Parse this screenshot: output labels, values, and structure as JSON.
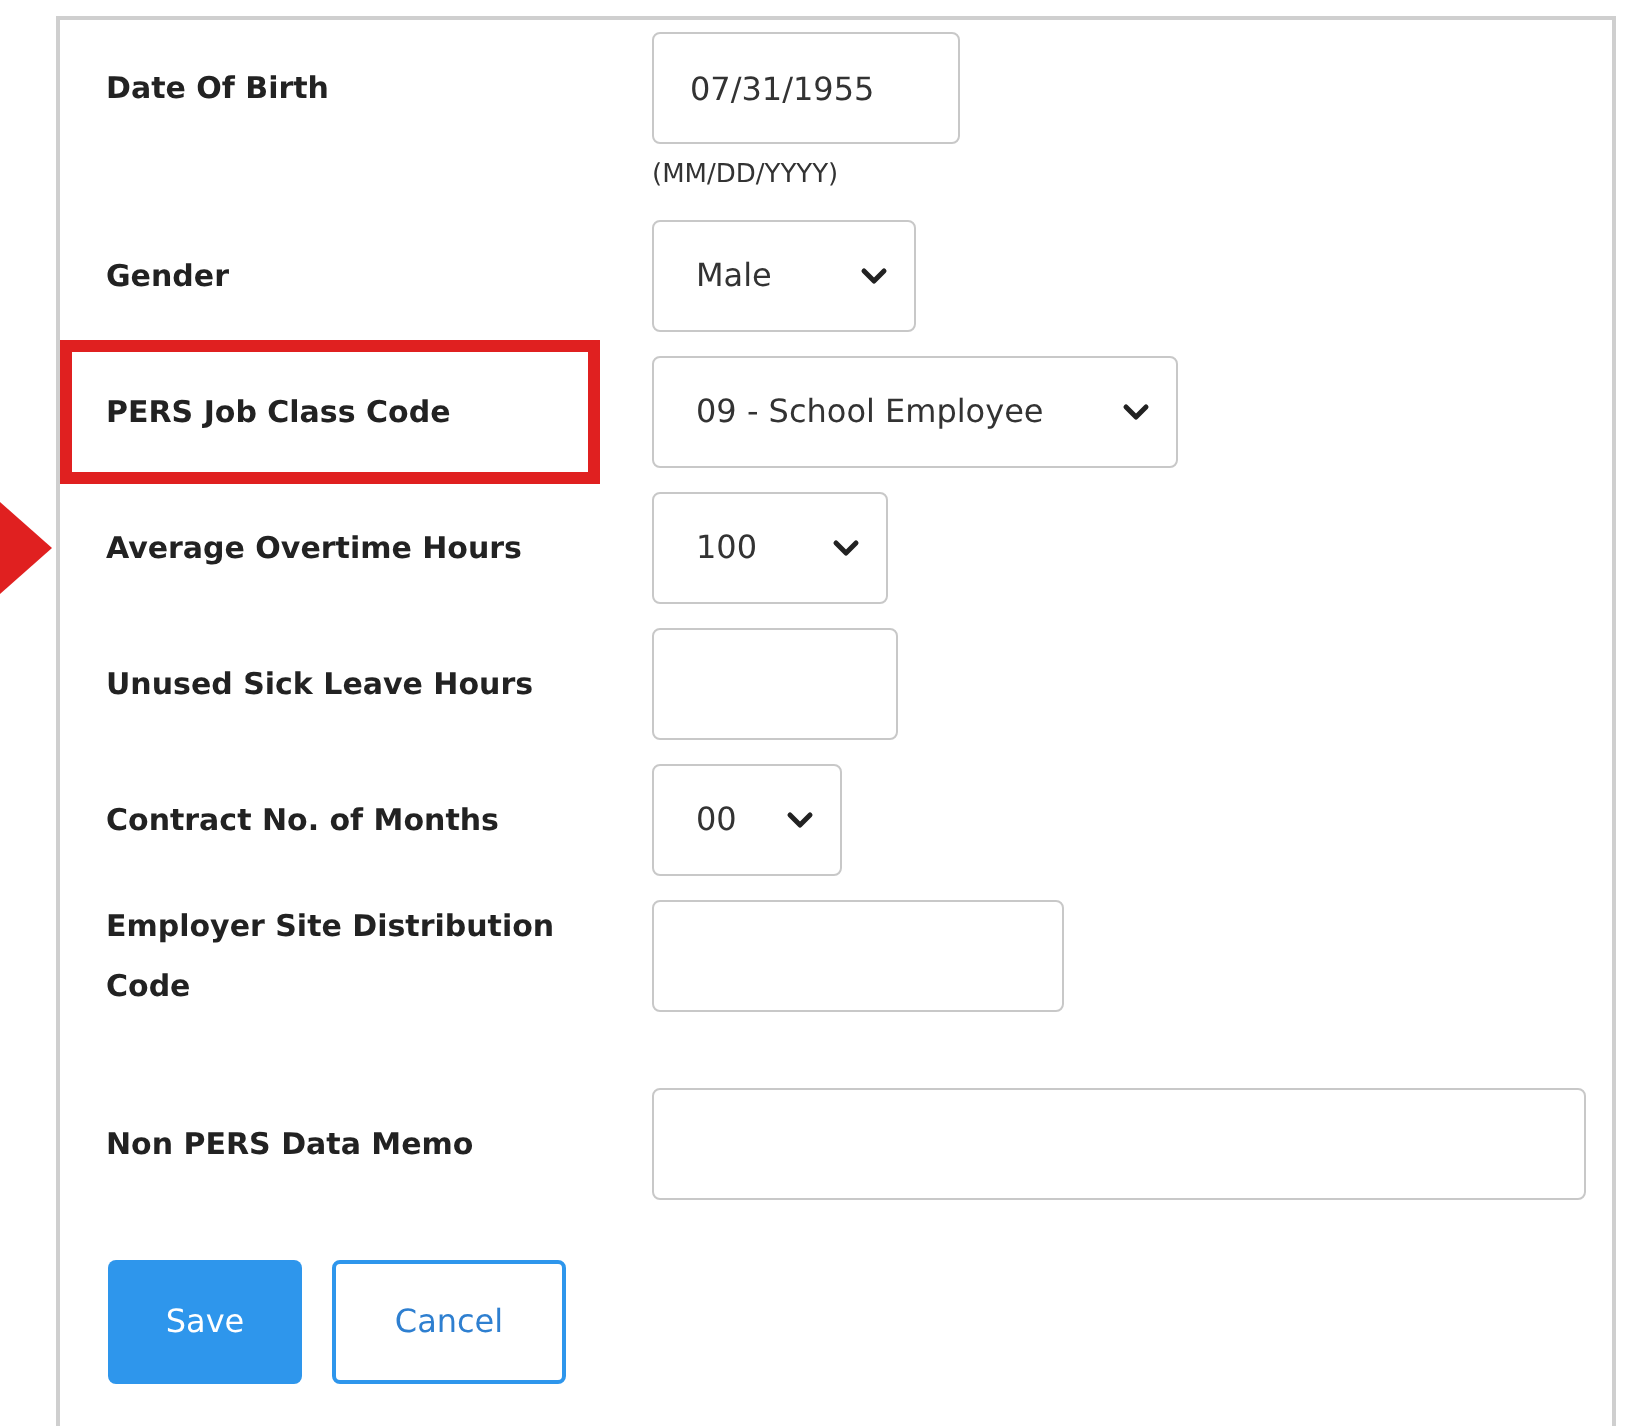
{
  "fields": [
    {
      "label": "Date Of Birth",
      "kind": "text",
      "value": "07/31/1955",
      "hint": "(MM/DD/YYYY)",
      "highlighted": false,
      "pointer": false
    },
    {
      "label": "Gender",
      "kind": "select",
      "value": "Male",
      "highlighted": false,
      "pointer": false
    },
    {
      "label": "PERS Job Class Code",
      "kind": "select",
      "value": "09 - School Employee",
      "highlighted": true,
      "pointer": false
    },
    {
      "label": "Average Overtime Hours",
      "kind": "select",
      "value": "100",
      "highlighted": false,
      "pointer": true
    },
    {
      "label": "Unused Sick Leave Hours",
      "kind": "text",
      "highlighted": false,
      "pointer": false
    },
    {
      "label": "Contract No. of Months",
      "kind": "select",
      "value": "00",
      "highlighted": false,
      "pointer": false
    },
    {
      "label": "Employer Site Distribution Code",
      "kind": "text",
      "highlighted": false,
      "pointer": false
    },
    {
      "label": "Non PERS Data Memo",
      "kind": "text",
      "highlighted": false,
      "pointer": false
    }
  ],
  "buttons": [
    {
      "label": "Save",
      "kind": "primary"
    },
    {
      "label": "Cancel",
      "kind": "secondary"
    }
  ]
}
